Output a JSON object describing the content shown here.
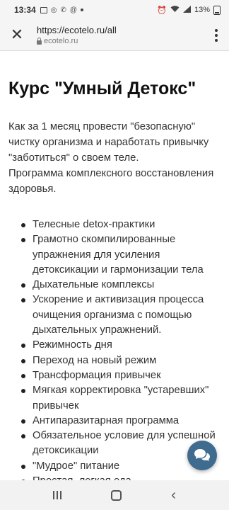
{
  "status_bar": {
    "time": "13:34",
    "battery": "13%"
  },
  "browser": {
    "url": "https://ecotelo.ru/all",
    "domain": "ecotelo.ru",
    "close_icon": "close-icon",
    "menu_icon": "more-vert-icon"
  },
  "page": {
    "title": "Курс \"Умный Детокс\"",
    "intro": [
      "Как за 1 месяц провести \"безопасную\" чистку организма и наработать привычку \"заботиться\" о своем теле.",
      "Программа комплексного восстановления здоровья."
    ],
    "items": [
      "Телесные detox-практики",
      "Грамотно скомпилированные упражнения для усиления детоксикации и гармонизации тела",
      "Дыхательные комплексы",
      "Ускорение и активизация процесса очищения организма с помощью дыхательных упражнений.",
      "Режимность дня",
      "Переход на новый режим",
      "Трансформация привычек",
      "Мягкая корректировка \"устаревших\" привычек",
      "Антипаразитарная программа",
      "Обязательное условие для успешной детоксикации",
      "\"Мудрое\" питание",
      "Простая, легкая еда"
    ]
  },
  "chat_button": {
    "icon": "chat-icon",
    "color": "#3f6b8f"
  },
  "nav_bar": {
    "recent_icon": "recent-apps-icon",
    "home_icon": "home-icon",
    "back_icon": "back-icon"
  }
}
